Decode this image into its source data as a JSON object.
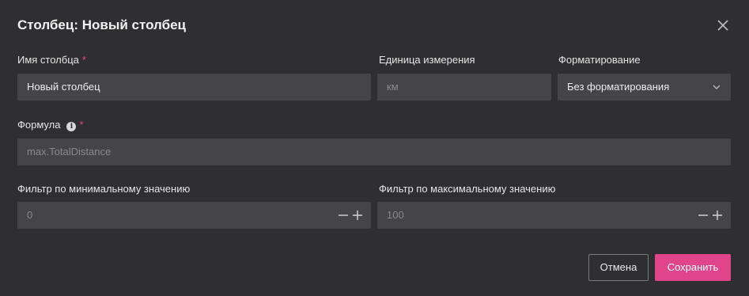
{
  "dialog": {
    "title": "Столбец: Новый столбец",
    "close_icon": "close-icon"
  },
  "fields": {
    "column_name": {
      "label": "Имя столбца",
      "required_mark": "*",
      "value": "Новый столбец"
    },
    "unit": {
      "label": "Единица измерения",
      "placeholder": "км"
    },
    "formatting": {
      "label": "Форматирование",
      "selected": "Без форматирования",
      "icon": "chevron-down-icon"
    },
    "formula": {
      "label": "Формула",
      "info_icon": "info-icon",
      "info_glyph": "i",
      "required_mark": "*",
      "placeholder": "max.TotalDistance"
    },
    "min_filter": {
      "label": "Фильтр по минимальному значению",
      "placeholder": "0"
    },
    "max_filter": {
      "label": "Фильтр по максимальному значению",
      "placeholder": "100"
    }
  },
  "buttons": {
    "cancel_label": "Отмена",
    "save_label": "Сохранить"
  },
  "colors": {
    "background": "#2f2f31",
    "field_background": "#454547",
    "accent": "#e0448a",
    "required": "#e0487d"
  }
}
